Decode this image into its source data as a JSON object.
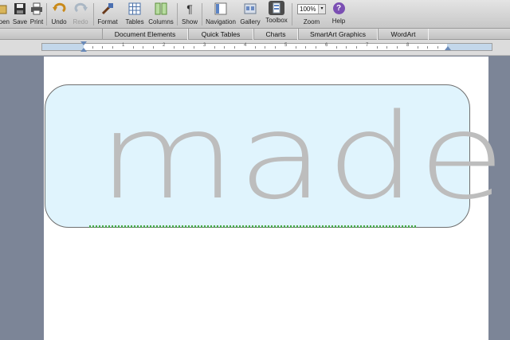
{
  "toolbar": {
    "items": [
      {
        "label": "Open",
        "icon": "folder-icon"
      },
      {
        "label": "Save",
        "icon": "floppy-icon"
      },
      {
        "label": "Print",
        "icon": "printer-icon"
      },
      {
        "label": "Undo",
        "icon": "undo-icon"
      },
      {
        "label": "Redo",
        "icon": "redo-icon"
      },
      {
        "label": "Format",
        "icon": "paintbrush-icon"
      },
      {
        "label": "Tables",
        "icon": "table-icon"
      },
      {
        "label": "Columns",
        "icon": "columns-icon"
      },
      {
        "label": "Show",
        "icon": "pilcrow-icon"
      },
      {
        "label": "Navigation",
        "icon": "navigation-icon"
      },
      {
        "label": "Gallery",
        "icon": "gallery-icon"
      },
      {
        "label": "Toolbox",
        "icon": "toolbox-icon"
      },
      {
        "label": "Zoom",
        "icon": "zoom-icon"
      },
      {
        "label": "Help",
        "icon": "help-icon"
      }
    ],
    "zoom_value": "100%",
    "pilcrow": "¶",
    "help_glyph": "?"
  },
  "ribbon": {
    "tabs": [
      "Document Elements",
      "Quick Tables",
      "Charts",
      "SmartArt Graphics",
      "WordArt"
    ]
  },
  "ruler": {
    "numbers": [
      "1",
      "2",
      "3",
      "4",
      "5",
      "6",
      "7",
      "8"
    ]
  },
  "document": {
    "banner_text": "made"
  },
  "colors": {
    "banner_fill": "#e0f4fd",
    "banner_text": "#bdbdbd",
    "workspace": "#7c8596"
  }
}
